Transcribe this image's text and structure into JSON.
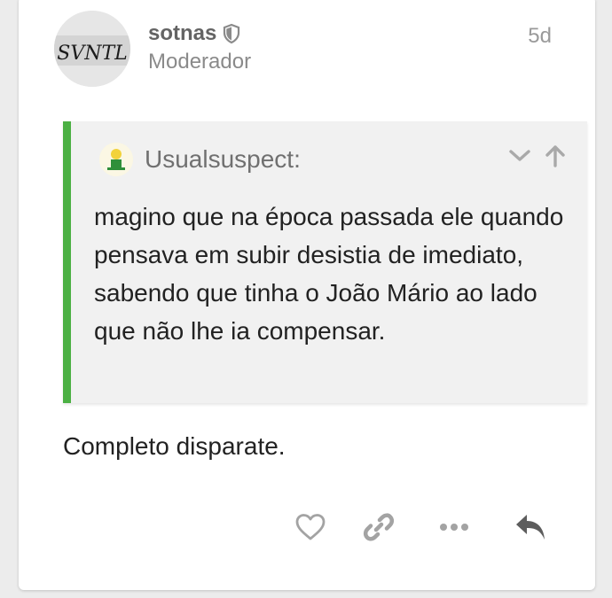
{
  "post": {
    "username": "sotnas",
    "role": "Moderador",
    "date": "5d",
    "avatar_text": "SVNTL",
    "body": "Completo disparate."
  },
  "quote": {
    "username": "Usualsuspect:",
    "text": "magino que na época passada ele quando pensava em subir desistia de imediato, sabendo que tinha o João Mário ao lado que não lhe ia compensar.",
    "accent_color": "#4bb043"
  },
  "actions": {
    "icons": [
      "heart-icon",
      "link-icon",
      "more-icon",
      "reply-icon"
    ]
  }
}
